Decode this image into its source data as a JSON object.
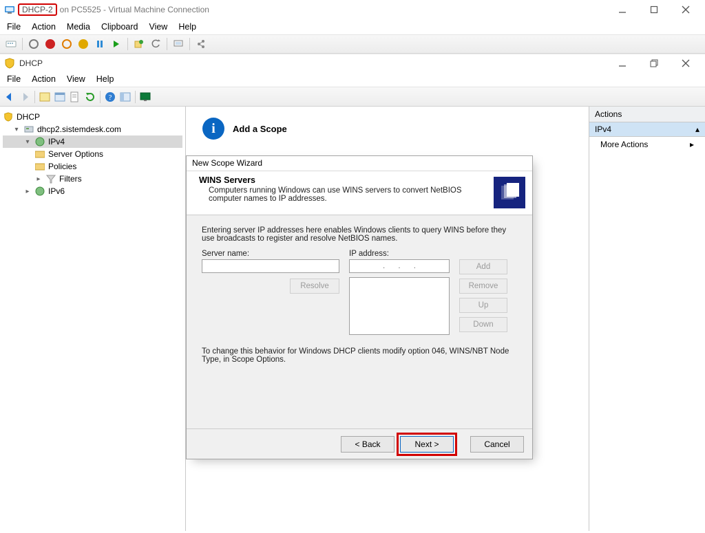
{
  "hv": {
    "vm_name": "DHCP-2",
    "title_rest": "on PC5525 - Virtual Machine Connection",
    "menu": [
      "File",
      "Action",
      "Media",
      "Clipboard",
      "View",
      "Help"
    ]
  },
  "mmc": {
    "app_title": "DHCP",
    "menu": [
      "File",
      "Action",
      "View",
      "Help"
    ]
  },
  "tree": {
    "root": "DHCP",
    "server": "dhcp2.sistemdesk.com",
    "ipv4": "IPv4",
    "server_options": "Server Options",
    "policies": "Policies",
    "filters": "Filters",
    "ipv6": "IPv6"
  },
  "center": {
    "heading": "Add a Scope"
  },
  "actions": {
    "title": "Actions",
    "selected": "IPv4",
    "more": "More Actions"
  },
  "wizard": {
    "window_title": "New Scope Wizard",
    "heading": "WINS Servers",
    "desc": "Computers running Windows can use WINS servers to convert NetBIOS computer names to IP addresses.",
    "intro": "Entering server IP addresses here enables Windows clients to query WINS before they use broadcasts to register and resolve NetBIOS names.",
    "server_name_label": "Server name:",
    "ip_label": "IP address:",
    "ip_placeholder": ".      .      .",
    "resolve": "Resolve",
    "add": "Add",
    "remove": "Remove",
    "up": "Up",
    "down": "Down",
    "note": "To change this behavior for Windows DHCP clients modify option 046, WINS/NBT Node Type, in Scope Options.",
    "back": "< Back",
    "next": "Next >",
    "cancel": "Cancel"
  }
}
